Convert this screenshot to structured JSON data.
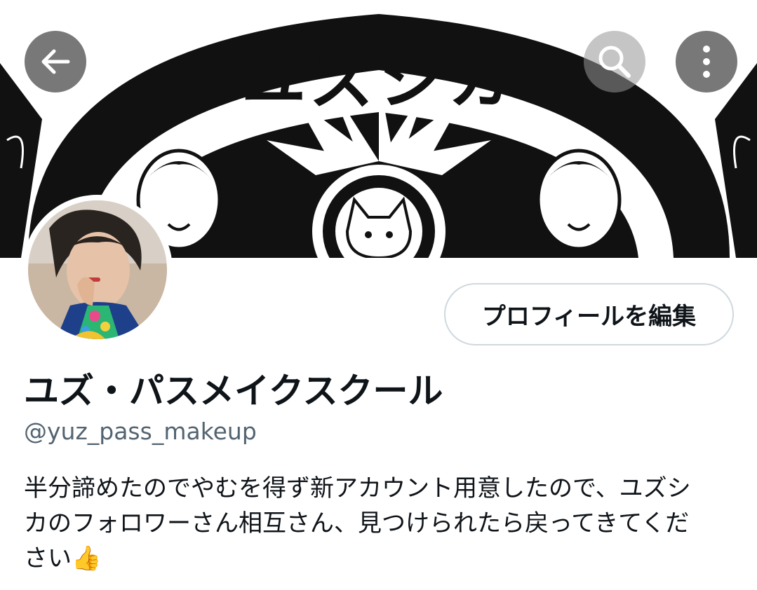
{
  "header": {
    "banner_title": "ユズシカ",
    "back_icon": "arrow-left-icon",
    "search_icon": "search-icon",
    "more_icon": "more-vertical-icon"
  },
  "profile": {
    "edit_button_label": "プロフィールを編集",
    "display_name": "ユズ・パスメイクスクール",
    "handle": "@yuz_pass_makeup",
    "bio_lines": [
      "半分諦めたのでやむを得ず新アカウント用意したので、ユズシ",
      "カのフォロワーさん相互さん、見つけられたら戻ってきてくだ",
      "さい"
    ],
    "bio_emoji": "👍"
  },
  "colors": {
    "text_primary": "#0f1419",
    "text_secondary": "#536471",
    "button_border": "#cfd9de"
  }
}
